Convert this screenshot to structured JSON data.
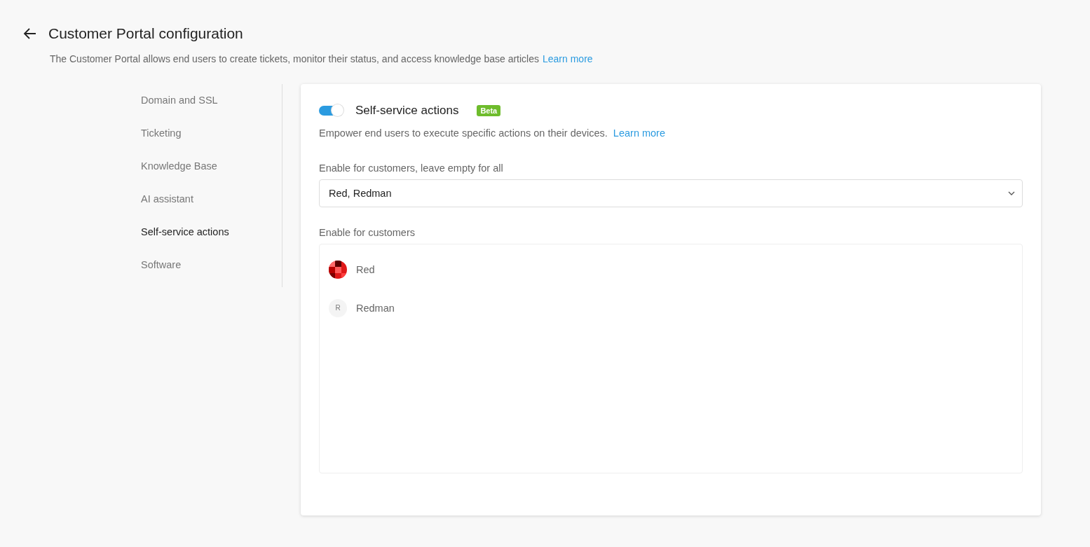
{
  "header": {
    "title": "Customer Portal configuration",
    "description": "The Customer Portal allows end users to create tickets, monitor their status, and access knowledge base articles",
    "link": "Learn more"
  },
  "sidebar": {
    "items": [
      {
        "label": "Domain and SSL",
        "selected": false
      },
      {
        "label": "Ticketing",
        "selected": false
      },
      {
        "label": "Knowledge Base",
        "selected": false
      },
      {
        "label": "AI assistant",
        "selected": false
      },
      {
        "label": "Self-service actions",
        "selected": true
      },
      {
        "label": "Software",
        "selected": false
      }
    ]
  },
  "panel": {
    "toggle": {
      "on": true
    },
    "title": "Self-service actions",
    "badge": "Beta",
    "description": "Empower end users to execute specific actions on their devices.",
    "link": "Learn more",
    "select": {
      "label": "Enable for customers, leave empty for all",
      "value": "Red, Redman"
    },
    "list_label": "Enable for customers",
    "customers": [
      {
        "name": "Red",
        "kind": "image"
      },
      {
        "name": "Redman",
        "kind": "initial",
        "initial": "R"
      }
    ]
  }
}
